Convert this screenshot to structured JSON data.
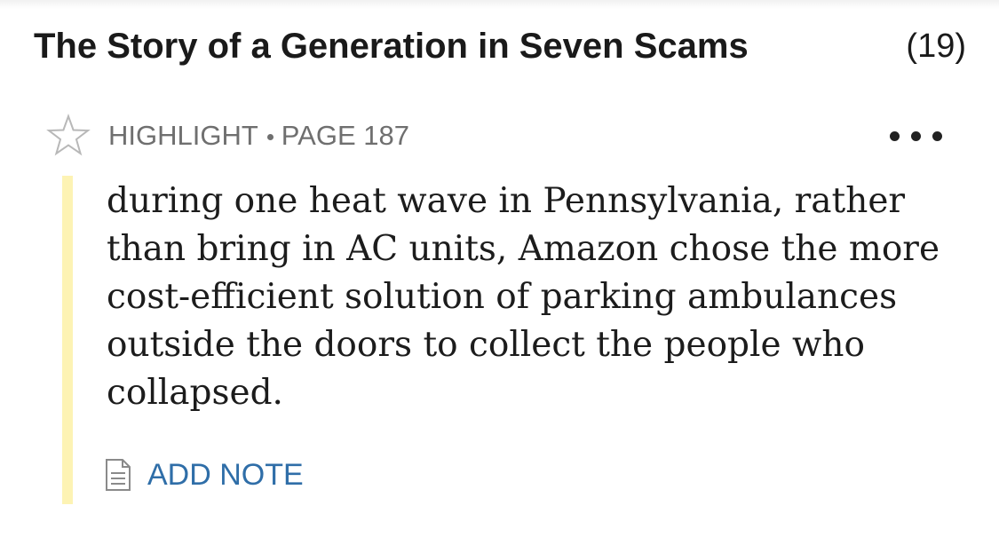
{
  "book": {
    "title": "The Story of a Generation in Seven Scams",
    "count": "(19)"
  },
  "annotation": {
    "type_label": "HIGHLIGHT",
    "page_label": "PAGE 187",
    "text": "during one heat wave in Pennsylvania, rather than bring in AC units, Amazon chose the more cost-efficient solution of parking ambulances outside the doors to collect the people who collapsed.",
    "highlight_color": "#fdf3b4",
    "favorited": false
  },
  "actions": {
    "add_note_label": "ADD NOTE",
    "add_note_color": "#2f6ea8",
    "more_icon": "more-dots-icon",
    "star_icon": "star-outline-icon",
    "note_icon": "note-document-icon"
  }
}
